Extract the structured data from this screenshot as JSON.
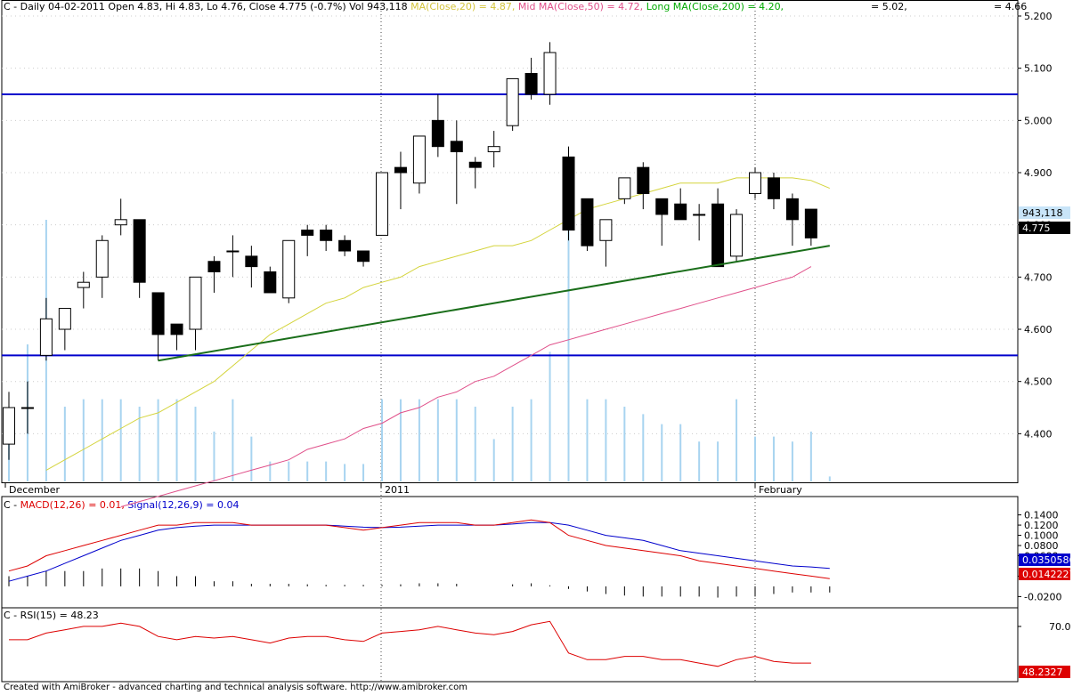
{
  "main_header": {
    "ticker_period": "C - Daily 04-02-2011",
    "ohlc": "Open 4.83, Hi 4.83, Lo 4.76, Close 4.775 (-0.7%)",
    "volume": "Vol 943,118",
    "ma20_label": "MA(Close,20) = 4.87,",
    "ma50_label": "Mid MA(Close,50) = 4.72,",
    "ma200_label": "Long MA(Close,200) = 4.20,",
    "extra1": "= 5.02,",
    "extra2": "= 4.66"
  },
  "macd_header": {
    "prefix": "C - ",
    "macd_label": "MACD(12,26) = 0.01,",
    "signal_label": "Signal(12,26,9) = 0.04"
  },
  "rsi_header": {
    "prefix": "C - ",
    "rsi_label": "RSI(15) = 48.23"
  },
  "footer_text": "Created with AmiBroker - advanced charting and technical analysis software. http://www.amibroker.com",
  "badges": {
    "volume": "943,118",
    "close": "4.775",
    "macd": "0.0350586",
    "signal": "0.0142227",
    "rsi": "48.2327"
  },
  "colors": {
    "up": "#ffffff",
    "down": "#000000",
    "volume": "#a8d4f0",
    "ma20": "#d4d43c",
    "ma50": "#e0508a",
    "ma200": "#00aa00",
    "macd": "#dd0000",
    "signal": "#0000cc",
    "hlines": "#0000cc",
    "trendline": "#1a6e1a"
  },
  "chart_data": [
    {
      "type": "candlestick",
      "title": "C - Daily",
      "x_labels": [
        "December",
        "2011",
        "February"
      ],
      "y_ticks": [
        4.4,
        4.5,
        4.6,
        4.7,
        4.8,
        4.9,
        5.0,
        5.1,
        5.2
      ],
      "y_tick_labels": [
        "4.400",
        "4.500",
        "4.600",
        "4.700",
        "4.800",
        "4.900",
        "5.000",
        "5.100",
        "5.200"
      ],
      "ylim": [
        4.32,
        5.22
      ],
      "ohlc": [
        [
          4.38,
          4.48,
          4.35,
          4.45
        ],
        [
          4.45,
          4.5,
          4.4,
          4.45
        ],
        [
          4.55,
          4.66,
          4.54,
          4.62
        ],
        [
          4.6,
          4.63,
          4.56,
          4.64
        ],
        [
          4.68,
          4.71,
          4.64,
          4.69
        ],
        [
          4.7,
          4.78,
          4.66,
          4.77
        ],
        [
          4.8,
          4.85,
          4.78,
          4.81
        ],
        [
          4.81,
          4.81,
          4.66,
          4.69
        ],
        [
          4.67,
          4.67,
          4.54,
          4.59
        ],
        [
          4.61,
          4.61,
          4.56,
          4.59
        ],
        [
          4.6,
          4.7,
          4.56,
          4.7
        ],
        [
          4.73,
          4.74,
          4.67,
          4.71
        ],
        [
          4.75,
          4.78,
          4.7,
          4.75
        ],
        [
          4.74,
          4.76,
          4.68,
          4.72
        ],
        [
          4.71,
          4.72,
          4.67,
          4.67
        ],
        [
          4.66,
          4.77,
          4.65,
          4.77
        ],
        [
          4.79,
          4.8,
          4.74,
          4.78
        ],
        [
          4.79,
          4.8,
          4.75,
          4.77
        ],
        [
          4.77,
          4.78,
          4.74,
          4.75
        ],
        [
          4.75,
          4.75,
          4.72,
          4.73
        ],
        [
          4.78,
          4.9,
          4.78,
          4.9
        ],
        [
          4.91,
          4.94,
          4.83,
          4.9
        ],
        [
          4.88,
          4.97,
          4.86,
          4.97
        ],
        [
          5.0,
          5.05,
          4.93,
          4.95
        ],
        [
          4.96,
          5.0,
          4.84,
          4.94
        ],
        [
          4.92,
          4.93,
          4.87,
          4.91
        ],
        [
          4.94,
          4.98,
          4.91,
          4.95
        ],
        [
          4.99,
          5.08,
          4.98,
          5.08
        ],
        [
          5.09,
          5.12,
          5.04,
          5.05
        ],
        [
          5.05,
          5.15,
          5.03,
          5.13
        ],
        [
          4.93,
          4.95,
          4.77,
          4.79
        ],
        [
          4.85,
          4.85,
          4.75,
          4.76
        ],
        [
          4.77,
          4.8,
          4.72,
          4.81
        ],
        [
          4.85,
          4.89,
          4.84,
          4.89
        ],
        [
          4.91,
          4.92,
          4.83,
          4.86
        ],
        [
          4.85,
          4.85,
          4.76,
          4.82
        ],
        [
          4.84,
          4.87,
          4.81,
          4.81
        ],
        [
          4.82,
          4.84,
          4.77,
          4.82
        ],
        [
          4.84,
          4.87,
          4.72,
          4.72
        ],
        [
          4.74,
          4.83,
          4.73,
          4.82
        ],
        [
          4.86,
          4.91,
          4.85,
          4.9
        ],
        [
          4.89,
          4.9,
          4.83,
          4.85
        ],
        [
          4.85,
          4.86,
          4.76,
          4.81
        ],
        [
          4.83,
          4.83,
          4.76,
          4.775
        ]
      ],
      "volume": [
        0.23,
        0.55,
        1.05,
        0.3,
        0.33,
        0.33,
        0.33,
        0.3,
        0.33,
        0.33,
        0.3,
        0.2,
        0.33,
        0.18,
        0.08,
        0.08,
        0.08,
        0.08,
        0.07,
        0.07,
        0.33,
        0.33,
        0.33,
        0.33,
        0.33,
        0.3,
        0.17,
        0.3,
        0.33,
        0.52,
        1.02,
        0.33,
        0.33,
        0.3,
        0.27,
        0.23,
        0.23,
        0.16,
        0.16,
        0.33,
        0.18,
        0.18,
        0.16,
        0.2,
        0.02
      ],
      "ma20": [
        4.33,
        4.35,
        4.37,
        4.39,
        4.41,
        4.43,
        4.44,
        4.46,
        4.48,
        4.5,
        4.53,
        4.56,
        4.59,
        4.61,
        4.63,
        4.65,
        4.66,
        4.68,
        4.69,
        4.7,
        4.72,
        4.73,
        4.74,
        4.75,
        4.76,
        4.76,
        4.77,
        4.79,
        4.81,
        4.83,
        4.84,
        4.85,
        4.86,
        4.87,
        4.88,
        4.88,
        4.88,
        4.89,
        4.89,
        4.89,
        4.89,
        4.885,
        4.87
      ],
      "ma50": [
        4.26,
        4.27,
        4.28,
        4.29,
        4.3,
        4.31,
        4.32,
        4.33,
        4.34,
        4.35,
        4.37,
        4.38,
        4.39,
        4.41,
        4.42,
        4.44,
        4.45,
        4.47,
        4.48,
        4.5,
        4.51,
        4.53,
        4.55,
        4.57,
        4.58,
        4.59,
        4.6,
        4.61,
        4.62,
        4.63,
        4.64,
        4.65,
        4.66,
        4.67,
        4.68,
        4.69,
        4.7,
        4.72
      ],
      "horizontal_lines": [
        5.05,
        4.55
      ],
      "trendline": {
        "from": [
          8,
          4.54
        ],
        "to": [
          44,
          4.76
        ]
      }
    },
    {
      "type": "line",
      "title": "MACD",
      "y_tick_labels": [
        "0.1400",
        "0.1200",
        "0.1000",
        "0.0800",
        "0.0600",
        "0.0200",
        "-0.0200"
      ],
      "ylim": [
        -0.035,
        0.155
      ],
      "series": [
        {
          "name": "MACD(12,26)",
          "values": [
            0.03,
            0.04,
            0.06,
            0.07,
            0.08,
            0.09,
            0.1,
            0.11,
            0.12,
            0.12,
            0.125,
            0.125,
            0.125,
            0.12,
            0.12,
            0.12,
            0.12,
            0.12,
            0.115,
            0.11,
            0.115,
            0.12,
            0.125,
            0.125,
            0.125,
            0.12,
            0.12,
            0.125,
            0.13,
            0.125,
            0.1,
            0.09,
            0.08,
            0.075,
            0.07,
            0.065,
            0.06,
            0.05,
            0.045,
            0.04,
            0.035,
            0.03,
            0.025,
            0.02,
            0.015
          ]
        },
        {
          "name": "Signal(12,26,9)",
          "values": [
            0.01,
            0.02,
            0.03,
            0.045,
            0.06,
            0.075,
            0.09,
            0.1,
            0.11,
            0.115,
            0.118,
            0.12,
            0.12,
            0.12,
            0.12,
            0.12,
            0.12,
            0.12,
            0.118,
            0.116,
            0.115,
            0.116,
            0.118,
            0.12,
            0.12,
            0.12,
            0.12,
            0.122,
            0.125,
            0.125,
            0.12,
            0.11,
            0.1,
            0.095,
            0.09,
            0.08,
            0.07,
            0.065,
            0.06,
            0.055,
            0.05,
            0.045,
            0.04,
            0.038,
            0.035
          ]
        }
      ],
      "histogram": [
        0.02,
        0.02,
        0.03,
        0.03,
        0.03,
        0.035,
        0.035,
        0.035,
        0.03,
        0.02,
        0.02,
        0.01,
        0.01,
        0.005,
        0.005,
        0.005,
        0.004,
        0.003,
        0.003,
        0.003,
        0.003,
        0.004,
        0.006,
        0.006,
        0.005,
        0.0,
        0.0,
        0.004,
        0.006,
        0.002,
        -0.005,
        -0.01,
        -0.015,
        -0.018,
        -0.02,
        -0.02,
        -0.02,
        -0.02,
        -0.022,
        -0.02,
        -0.02,
        -0.015,
        -0.012,
        -0.012,
        -0.012
      ]
    },
    {
      "type": "line",
      "title": "RSI",
      "y_tick_labels": [
        "70.0"
      ],
      "ylim": [
        40,
        78
      ],
      "series": [
        {
          "name": "RSI(15)",
          "values": [
            62,
            62,
            66,
            68,
            70,
            70,
            72,
            70,
            64,
            62,
            64,
            63,
            64,
            62,
            60,
            63,
            64,
            64,
            62,
            61,
            66,
            67,
            68,
            70,
            68,
            66,
            65,
            67,
            71,
            73,
            54,
            50,
            50,
            52,
            52,
            50,
            50,
            48,
            46,
            50,
            52,
            49,
            48,
            48
          ]
        }
      ]
    }
  ]
}
